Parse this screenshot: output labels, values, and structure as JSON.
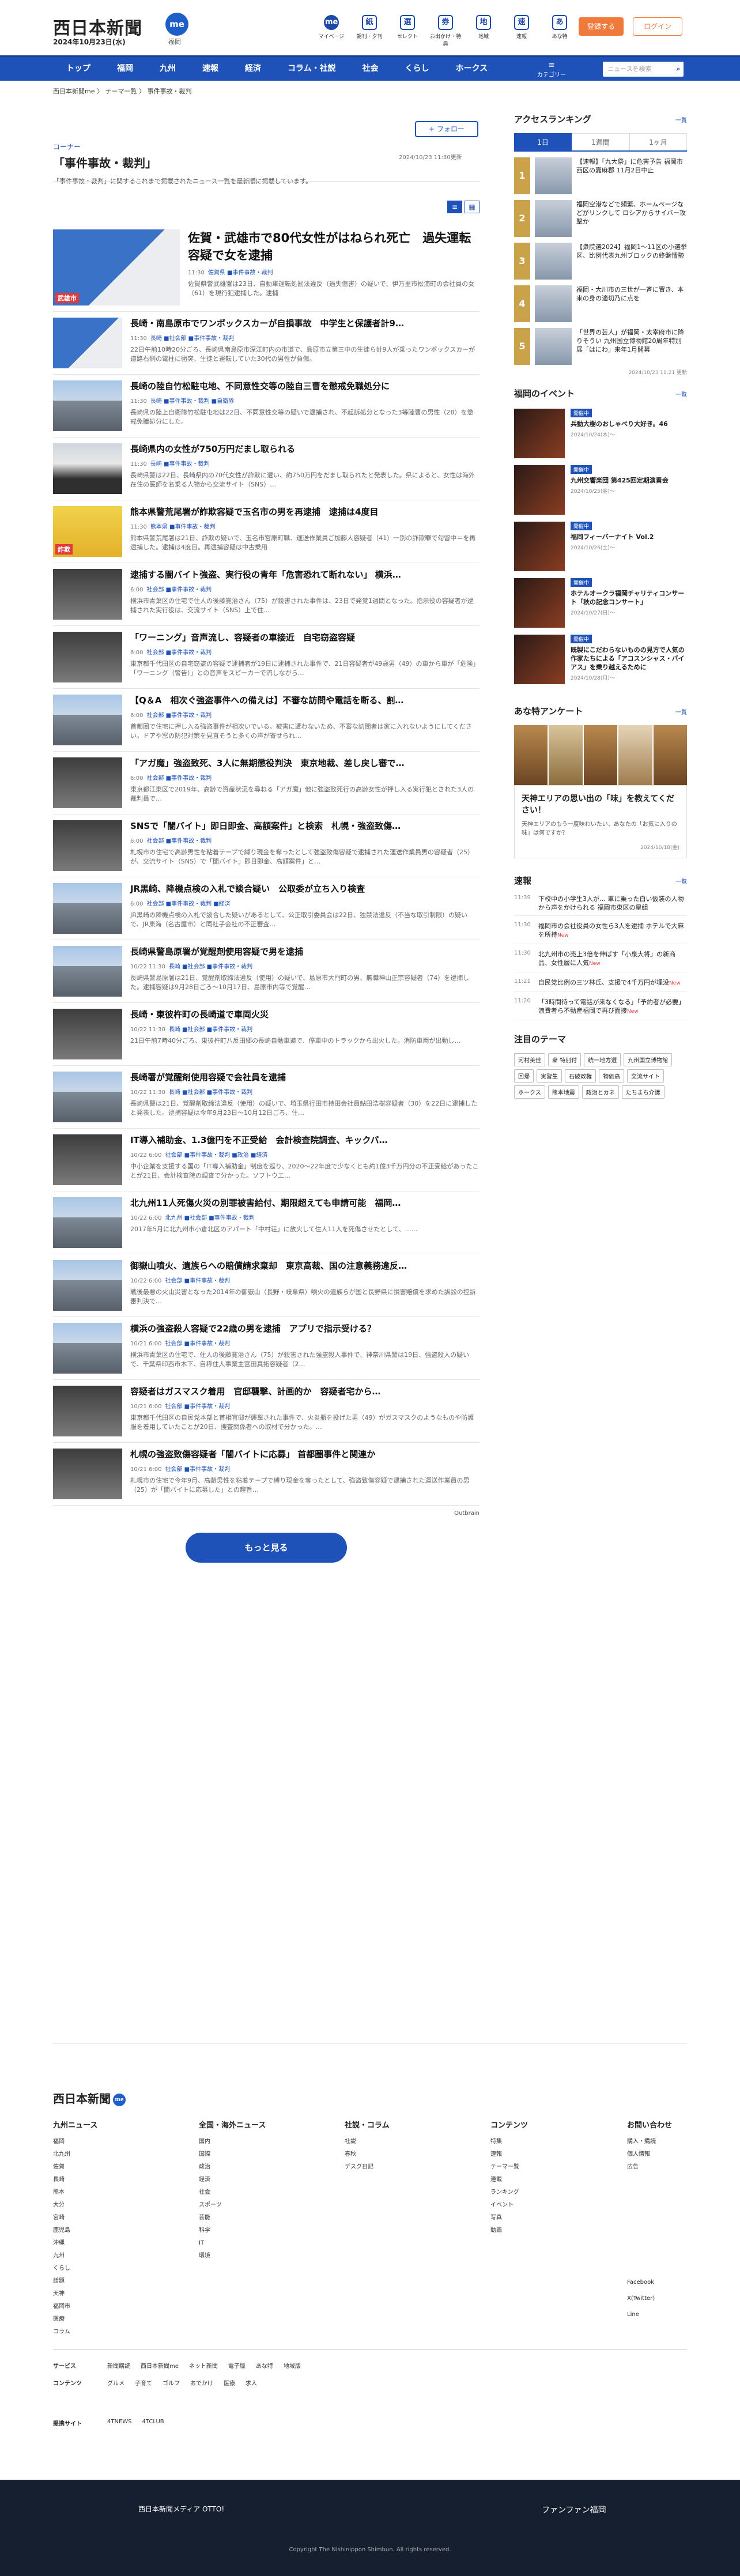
{
  "header": {
    "logo": "西日本新聞",
    "logo_badge": "me",
    "date": "2024年10月23日(水)",
    "location": "福岡",
    "icons": [
      {
        "label": "マイページ",
        "glyph": "me"
      },
      {
        "label": "朝刊・夕刊",
        "glyph": "紙"
      },
      {
        "label": "セレクト",
        "glyph": "選"
      },
      {
        "label": "お出かけ・特典",
        "glyph": "券"
      },
      {
        "label": "地域",
        "glyph": "地"
      },
      {
        "label": "速報",
        "glyph": "速"
      },
      {
        "label": "あな特",
        "glyph": "あ"
      }
    ],
    "register": "登録する",
    "login": "ログイン"
  },
  "nav": {
    "items": [
      "トップ",
      "福岡",
      "九州",
      "速報",
      "経済",
      "コラム・社説",
      "社会",
      "くらし",
      "ホークス"
    ],
    "category": "カテゴリー",
    "search_placeholder": "ニュースを検索"
  },
  "breadcrumb": "西日本新聞me  〉 テーマ一覧 〉 事件事故・裁判",
  "page": {
    "corner_label": "コーナー",
    "title": "「事件事故・裁判」",
    "description": "「事件事故・裁判」に関するこれまで掲載されたニュース一覧を最新順に掲載しています。",
    "follow": "+ フォロー",
    "updated": "2024/10/23 11:30更新"
  },
  "articles": [
    {
      "thumb": "map",
      "tag": "武雄市",
      "title": "佐賀・武雄市で80代女性がはねられ死亡　過失運転容疑で女を逮捕",
      "time": "11:30",
      "cats": "佐賀県 ■事件事故・裁判",
      "summary": "佐賀県警武雄署は23日、自動車運転処罰法違反（過失傷害）の疑いで、伊万里市松浦町の会社員の女（61）を現行犯逮捕した。逮捕"
    },
    {
      "thumb": "map",
      "tag": "",
      "title": "長崎・南島原市でワンボックスカーが自損事故　中学生と保護者計9…",
      "time": "11:30",
      "cats": "長崎 ■社会部 ■事件事故・裁判",
      "summary": "22日午前10時20分ごろ、長崎県南島原市深江町内の市道で、島原市立第三中の生徒ら計9人が乗ったワンボックスカーが道路右側の電柱に衝突、生徒と運転していた30代の男性が負傷。"
    },
    {
      "thumb": "bld",
      "tag": "",
      "title": "長崎の陸自竹松駐屯地、不同意性交等の陸自三曹を懲戒免職処分に",
      "time": "11:30",
      "cats": "長崎 ■事件事故・裁判 ■自衛隊",
      "summary": "長崎県の陸上自衛隊竹松駐屯地は22日、不同意性交等の疑いで逮捕され、不起訴処分となった3等陸曹の男性（28）を懲戒免職処分にした。"
    },
    {
      "thumb": "car",
      "tag": "",
      "title": "長崎県内の女性が750万円だまし取られる",
      "time": "11:30",
      "cats": "長崎 ■事件事故・裁判",
      "summary": "長崎県警は22日、長崎県内の70代女性が詐欺に遭い、約750万円をだまし取られたと発表した。県によると、女性は海外在住の医師を名乗る人物から交流サイト（SNS）…"
    },
    {
      "thumb": "poster",
      "tag": "詐欺",
      "title": "熊本県警荒尾署が詐欺容疑で玉名市の男を再逮捕　逮捕は4度目",
      "time": "11:30",
      "cats": "熊本県 ■事件事故・裁判",
      "summary": "熊本県警荒尾署は21日、詐欺の疑いで、玉名市宮原町職、運送作業員ご加藤人容疑者（41）一別の詐欺罪で勾留中＝を再逮捕した。逮捕は4度目。再逮捕容疑は中古乗用"
    },
    {
      "thumb": "dk",
      "tag": "",
      "title": "逮捕する闇バイト強盗、実行役の青年「危害恐れて断れない」 横浜…",
      "time": "6:00",
      "cats": "社会部 ■事件事故・裁判",
      "summary": "横浜市青葉区の住宅で住人の後藤寛治さん（75）が殺害された事件は、23日で発覚1週間となった。指示役の容疑者が逮捕された実行役は、交流サイト（SNS）上で住…"
    },
    {
      "thumb": "dk",
      "tag": "",
      "title": "「ワーニング」音声流し、容疑者の車接近　自宅窃盗容疑",
      "time": "6:00",
      "cats": "社会部 ■事件事故・裁判",
      "summary": "東京都千代田区の自宅窃盗の容疑で逮捕者が19日に逮捕された事件で、21日容疑者が49歳男（49）の車から車が「危険」「ワーニング（警告）」との音声をスピーカーで流しながら…"
    },
    {
      "thumb": "bld",
      "tag": "",
      "title": "【Q＆A　相次ぐ強盗事件への備えは】不審な訪問や電話を断る、割…",
      "time": "6:00",
      "cats": "社会部 ■事件事故・裁判",
      "summary": "首都圏で住宅に押し入る強盗事件が相次いでいる。被害に遭わないため、不審な訪問者は家に入れないようにしてください。ドアや窓の防犯対策を見直そうと多くの声が寄せられ…"
    },
    {
      "thumb": "dk",
      "tag": "",
      "title": "「アガ魔」強盗致死、3人に無期懲役判決　東京地裁、差し戻し審で…",
      "time": "6:00",
      "cats": "社会部 ■事件事故・裁判",
      "summary": "東京都江東区で2019年、高齢で資産状況を尋ねる「アガ魔」他に強盗致死行の高齢女性が押し入る実行犯とされた3人の裁判員で…"
    },
    {
      "thumb": "dk",
      "tag": "",
      "title": "SNSで「闇バイト」即日即金、高額案件」と検索　札幌・強盗致傷…",
      "time": "6:00",
      "cats": "社会部 ■事件事故・裁判",
      "summary": "札幌市の住宅で高齢男性を粘着テープで縛り現金を奪ったとして強盗致傷容疑で逮捕された運送作業員男の容疑者（25）が、交流サイト（SNS）で「闇バイト」即日即金、高額案件」と…"
    },
    {
      "thumb": "bld",
      "tag": "",
      "title": "JR黒崎、降機点検の入札で談合疑い　公取委が立ち入り検査",
      "time": "6:00",
      "cats": "社会部 ■事件事故・裁判 ■経済",
      "summary": "JR黒崎の降機点検の入札で談合した疑いがあるとして、公正取引委員会は22日、独禁法違反（不当な取引制限）の疑いで、JR東海（名古屋市）と同社子会社の不正審査…"
    },
    {
      "thumb": "bld",
      "tag": "",
      "title": "長崎県警島原署が覚醒剤使用容疑で男を逮捕",
      "time": "10/22 11:30",
      "cats": "長崎 ■社会部 ■事件事故・裁判",
      "summary": "長崎県警島原署は21日、覚醒剤取締法違反（使用）の疑いで、島原市大門町の男、無職神山正宗容疑者（74）を逮捕した。逮捕容疑は9月28日ごろ〜10月17日、島原市内等で覚醒…"
    },
    {
      "thumb": "dk",
      "tag": "",
      "title": "長崎・東彼杵町の長崎道で車両火災",
      "time": "10/22 11:30",
      "cats": "長崎 ■社会部 ■事件事故・裁判",
      "summary": "21日午前7時40分ごろ、東彼杵町八反田郷の長崎自動車道で、停車中のトラックから出火した。消防車両が出動し…"
    },
    {
      "thumb": "bld",
      "tag": "",
      "title": "長崎署が覚醒剤使用容疑で会社員を逮捕",
      "time": "10/22 11:30",
      "cats": "長崎 ■社会部 ■事件事故・裁判",
      "summary": "長崎県警は21日、覚醒剤取締法違反（使用）の疑いで、埼玉県行田市持田会社員鮎田浩樹容疑者（30）を22日に逮捕したと発表した。逮捕容疑は今年9月23日〜10月12日ごろ、住…"
    },
    {
      "thumb": "dk",
      "tag": "",
      "title": "IT導入補助金、1.3億円を不正受給　会計検査院調査、キックバ…",
      "time": "10/22 6:00",
      "cats": "社会部 ■事件事故・裁判 ■政治 ■経済",
      "summary": "中小企業を支援する国の「IT導入補助金」制度を巡り、2020～22年度で少なくとも約1億3千万円分の不正受給があったことが21日、会計検査院の調査で分かった。ソフトウエ…"
    },
    {
      "thumb": "bld",
      "tag": "",
      "title": "北九州11人死傷火災の別罪被害給付、期限超えても申請可能　福岡…",
      "time": "10/22 6:00",
      "cats": "北九州 ■社会部 ■事件事故・裁判",
      "summary": "2017年5月に北九州市小倉北区のアパート「中村荘」に放火して住人11人を死傷させたとして、……"
    },
    {
      "thumb": "bld",
      "tag": "",
      "title": "御嶽山噴火、遺族らへの賠償請求棄却　東京高裁、国の注意義務違反…",
      "time": "10/22 6:00",
      "cats": "社会部 ■事件事故・裁判",
      "summary": "戦後最悪の火山災害となった2014年の御嶽山（長野・岐阜県）噴火の遺族らが国と長野県に損害賠償を求めた訴訟の控訴審判決で…"
    },
    {
      "thumb": "bld",
      "tag": "",
      "title": "横浜の強盗殺人容疑で22歳の男を逮捕　アプリで指示受ける？",
      "time": "10/21 6:00",
      "cats": "社会部 ■事件事故・裁判",
      "summary": "横浜市青葉区の住宅で、住人の後藤寛治さん（75）が殺害された強盗殺人事件で、神奈川県警は19日、強盗殺人の疑いで、千葉県印西市木下、自称住人事業主宮田真拓容疑者（2…"
    },
    {
      "thumb": "dk",
      "tag": "",
      "title": "容疑者はガスマスク着用　官邸襲撃、計画的か　容疑者宅から…",
      "time": "10/21 6:00",
      "cats": "社会部 ■事件事故・裁判",
      "summary": "東京都千代田区の自民党本部と首相官邸が襲撃された事件で、火炎瓶を投げた男（49）がガスマスクのようなものや防護服を着用していたことが20日、捜査関係者への取材で分かった。…"
    },
    {
      "thumb": "dk",
      "tag": "",
      "title": "札幌の強盗致傷容疑者「闇バイトに応募」 首都圏事件と関連か",
      "time": "10/21 6:00",
      "cats": "社会部 ■事件事故・裁判",
      "summary": "札幌市の住宅で今年9月、高齢男性を粘着テープで縛り現金を奪ったとして、強盗致傷容疑で逮捕された運送作業員の男（25）が「闇バイトに応募した」との趣旨…"
    }
  ],
  "outbrain": "Outbrain",
  "more_button": "もっと見る",
  "sidebar": {
    "ranking_title": "アクセスランキング",
    "ranking_more": "一覧",
    "tabs": [
      "1日",
      "1週間",
      "1ヶ月"
    ],
    "ranking": [
      {
        "num": "1",
        "text": "【速報】「九大祭」に危害予告 福岡市西区の嘉麻郡 11月2日中止"
      },
      {
        "num": "2",
        "text": "福岡空港などで頻繁、ホームページなどがリンクして ロシアからサイバー攻撃か"
      },
      {
        "num": "3",
        "text": "【衆院選2024】福岡1〜11区の小選挙区、比例代表九州ブロックの終盤情勢"
      },
      {
        "num": "4",
        "text": "福岡・大川市の三世が一斉に置き、本来の身の適切乃に点を"
      },
      {
        "num": "5",
        "text": "「世界の芸人」が福岡・太宰府市に降りそうい 九州国立博物館20周年特別展「はにわ」来年1月開幕"
      }
    ],
    "ranking_updated": "2024/10/23 11:21 更新",
    "events_title": "福岡のイベント",
    "events_more": "一覧",
    "events": [
      {
        "badge": "開催中",
        "title": "兵動大樹のおしゃべり大好き。46",
        "date": "2024/10/24(木)〜"
      },
      {
        "badge": "開催中",
        "title": "九州交響楽団 第425回定期演奏会",
        "date": "2024/10/25(金)〜"
      },
      {
        "badge": "開催中",
        "title": "福岡フィーバーナイト Vol.2",
        "date": "2024/10/26(土)〜"
      },
      {
        "badge": "開催中",
        "title": "ホテルオークラ福岡チャリティコンサート「秋の記念コンサート」",
        "date": "2024/10/27(日)〜"
      },
      {
        "badge": "開催中",
        "title": "既製にこだわらないものの見方で人気の作家たちによる「アコスンシャス・バイアス」を乗り越えるために",
        "date": "2024/10/28(月)〜"
      }
    ],
    "survey_title": "あな特アンケート",
    "survey_more": "一覧",
    "survey_question": "天神エリアの思い出の「味」を教えてください！",
    "survey_desc": "天神エリアのもう一度味わいたい、あなたの「お気に入りの味」は何ですか？",
    "survey_date": "2024/10/18(金)",
    "breaking_title": "速報",
    "breaking_more": "一覧",
    "breaking": [
      {
        "time": "11:39",
        "text": "下校中の小学生3人が… 車に乗った白い仮装の人物から声をかけられる 福岡市東区の星組",
        "new": ""
      },
      {
        "time": "11:30",
        "text": "福岡市の会社役員の女性ら3人を逮捕 ホテルで大麻を所持",
        "new": "New"
      },
      {
        "time": "11:30",
        "text": "北九州市の売上3倍を伸ばす「小泉大将」の新商品、女性層に人気",
        "new": "New"
      },
      {
        "time": "11:21",
        "text": "自民党比例の三ツ林氏、支援で4千万円が埋没",
        "new": "New"
      },
      {
        "time": "11:20",
        "text": "「3時間待って電話が来なくなる」「予約者が必要」浪費者ら不動産福岡で再び面接",
        "new": "New"
      }
    ],
    "themes_title": "注目のテーマ",
    "themes": [
      "河村美佳",
      "衆 特別付",
      "統一地方選",
      "九州国立博物館",
      "回帰",
      "実習生",
      "石破政権",
      "物価高",
      "交流サイト",
      "ホークス",
      "熊本地震",
      "政治とカネ",
      "たちまち介護"
    ]
  },
  "footer": {
    "logo": "西日本新聞",
    "logo_badge": "me",
    "cols": [
      {
        "title": "九州ニュース",
        "items": [
          "福岡",
          "北九州",
          "佐賀",
          "長崎",
          "熊本",
          "大分",
          "宮崎",
          "鹿児島",
          "沖縄",
          "九州",
          "くらし",
          "話題",
          "天神",
          "福岡市",
          "医療",
          "コラム"
        ]
      },
      {
        "title": "全国・海外ニュース",
        "items": [
          "国内",
          "国際",
          "政治",
          "経済",
          "社会",
          "スポーツ",
          "芸能",
          "科学",
          "IT",
          "環境"
        ]
      },
      {
        "title": "社説・コラム",
        "items": [
          "社説",
          "春秋",
          "デスク日記"
        ]
      },
      {
        "title": "コンテンツ",
        "items": [
          "特集",
          "速報",
          "テーマ一覧",
          "連載",
          "ランキング",
          "イベント",
          "写真",
          "動画"
        ]
      },
      {
        "title": "お問い合わせ",
        "items": [
          "購入・購読",
          "個人情報",
          "広告"
        ]
      }
    ],
    "services_label": "サービス",
    "services": [
      "新聞購読",
      "西日本新聞me",
      "ネット新聞",
      "電子版",
      "あな特",
      "地域版"
    ],
    "contents_label": "コンテンツ",
    "contents": [
      "グルメ",
      "子育て",
      "ゴルフ",
      "おでかけ",
      "医療",
      "求人"
    ],
    "related_label": "提携サイト",
    "related": [
      "4TNEWS",
      "4TCLUB"
    ],
    "social": [
      "Facebook",
      "X(Twitter)",
      "Line"
    ],
    "bottom_left": "西日本新聞メディア OTTO!",
    "bottom_right": "ファンファン福岡",
    "copyright": "Copyright The Nishinippon Shimbun. All rights reserved."
  }
}
